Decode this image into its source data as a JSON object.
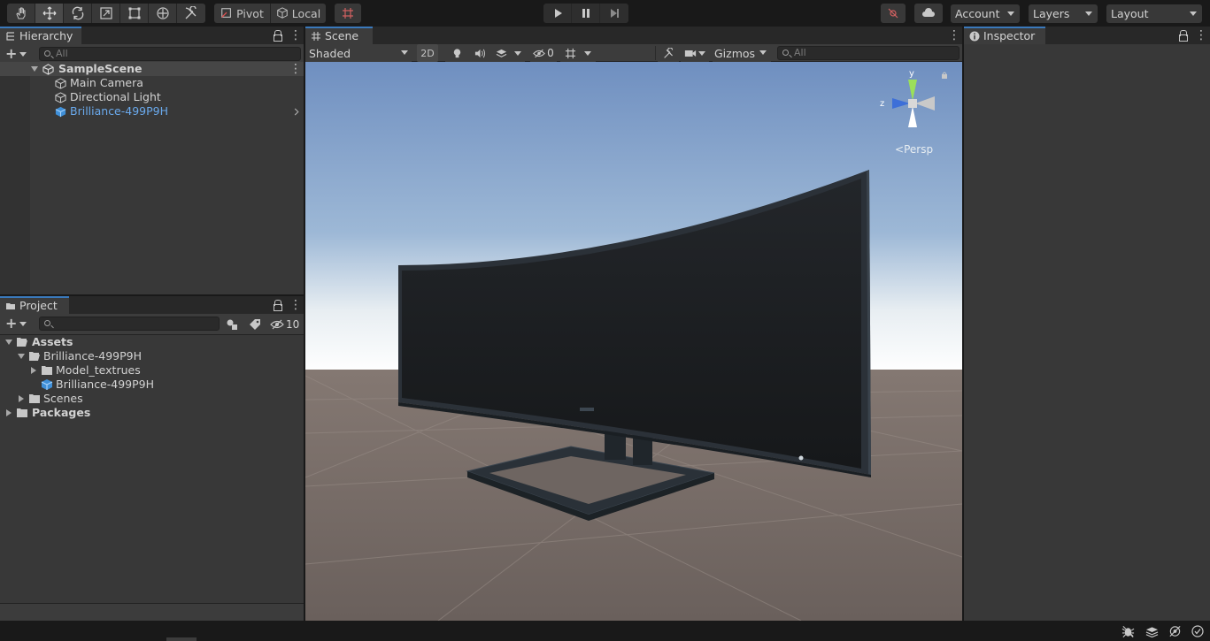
{
  "toolbar": {
    "tools": [
      "hand-tool",
      "move-tool",
      "rotate-tool",
      "scale-tool",
      "rect-tool",
      "transform-tool",
      "custom-tool"
    ],
    "pivot_label": "Pivot",
    "local_label": "Local",
    "account_label": "Account",
    "layers_label": "Layers",
    "layout_label": "Layout"
  },
  "hierarchy": {
    "tab_label": "Hierarchy",
    "search_placeholder": "All",
    "scene_name": "SampleScene",
    "items": [
      {
        "label": "Main Camera"
      },
      {
        "label": "Directional Light"
      },
      {
        "label": "Brilliance-499P9H"
      }
    ]
  },
  "project": {
    "tab_label": "Project",
    "hidden_count": "10",
    "tree": {
      "assets": "Assets",
      "brilliance_folder": "Brilliance-499P9H",
      "model_textures": "Model_textrues",
      "brilliance_model": "Brilliance-499P9H",
      "scenes": "Scenes",
      "packages": "Packages"
    }
  },
  "scene": {
    "tab_label": "Scene",
    "shading_mode": "Shaded",
    "mode_2d": "2D",
    "hidden_objects": "0",
    "gizmos_label": "Gizmos",
    "search_placeholder": "All",
    "persp_label": "Persp",
    "axis_y": "y",
    "axis_z": "z"
  },
  "inspector": {
    "tab_label": "Inspector"
  }
}
